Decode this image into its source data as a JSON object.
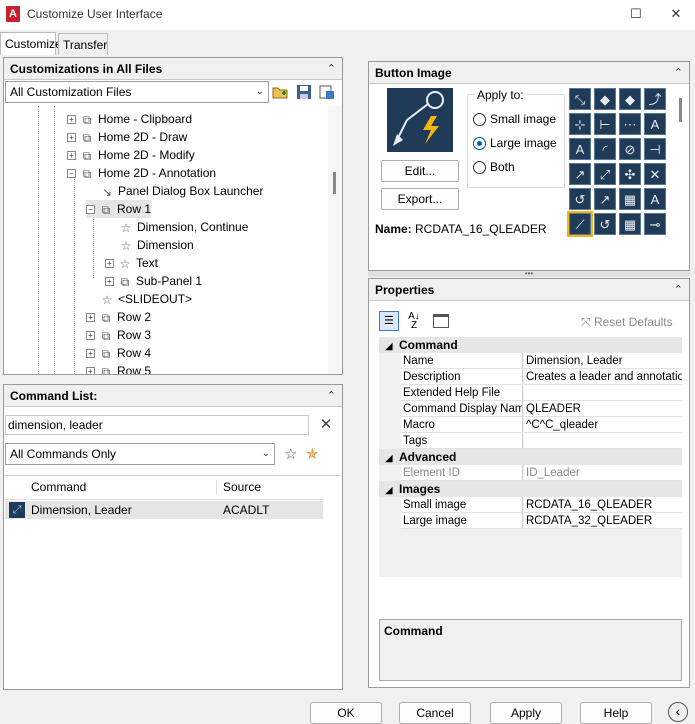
{
  "window": {
    "title": "Customize User Interface",
    "app_icon_letter": "A",
    "maximize_symbol": "☐",
    "close_symbol": "✕"
  },
  "tabs": [
    {
      "label": "Customize",
      "active": true
    },
    {
      "label": "Transfer",
      "active": false
    }
  ],
  "customizations_panel": {
    "title": "Customizations in All Files",
    "collapse_symbol": "⌃",
    "file_combo": "All Customization Files",
    "tree": [
      {
        "label": "Home - Clipboard",
        "expander": "+",
        "icon": "panel-icon"
      },
      {
        "label": "Home 2D - Draw",
        "expander": "+",
        "icon": "panel-icon"
      },
      {
        "label": "Home 2D - Modify",
        "expander": "+",
        "icon": "panel-icon"
      },
      {
        "label": "Home 2D - Annotation",
        "expander": "−",
        "icon": "panel-icon"
      },
      {
        "label": "Panel Dialog Box Launcher",
        "expander": "",
        "icon": "launcher-icon"
      },
      {
        "label": "Row 1",
        "expander": "−",
        "icon": "row-icon"
      },
      {
        "label": "Dimension, Continue",
        "expander": "",
        "icon": "command-star-icon"
      },
      {
        "label": "Dimension",
        "expander": "",
        "icon": "command-star-icon"
      },
      {
        "label": "Text",
        "expander": "+",
        "icon": "command-star-icon"
      },
      {
        "label": "Sub-Panel 1",
        "expander": "+",
        "icon": "subpanel-icon"
      },
      {
        "label": "<SLIDEOUT>",
        "expander": "",
        "icon": "command-star-icon"
      },
      {
        "label": "Row 2",
        "expander": "+",
        "icon": "row-icon"
      },
      {
        "label": "Row 3",
        "expander": "+",
        "icon": "row-icon"
      },
      {
        "label": "Row 4",
        "expander": "+",
        "icon": "row-icon"
      },
      {
        "label": "Row 5",
        "expander": "+",
        "icon": "row-icon"
      }
    ]
  },
  "command_list": {
    "title": "Command List:",
    "collapse_symbol": "⌃",
    "search_value": "dimension, leader",
    "clear_symbol": "✕",
    "filter_combo": "All Commands Only",
    "columns": [
      "Command",
      "Source"
    ],
    "rows": [
      {
        "command": "Dimension, Leader",
        "source": "ACADLT"
      }
    ]
  },
  "button_image": {
    "title": "Button Image",
    "collapse_symbol": "⌃",
    "edit_label": "Edit...",
    "export_label": "Export...",
    "apply_to_label": "Apply to:",
    "options": [
      {
        "label": "Small image",
        "selected": false
      },
      {
        "label": "Large image",
        "selected": true
      },
      {
        "label": "Both",
        "selected": false
      }
    ],
    "name_label": "Name:",
    "name_value": "RCDATA_16_QLEADER",
    "icon_grid_glyphs": [
      "⤡",
      "◆",
      "◆",
      "⤴",
      "⊹",
      "⊢",
      "⋯",
      "A",
      "A",
      "◜",
      "⊘",
      "⊣",
      "↗",
      "⤢",
      "✣",
      "✕",
      "↺",
      "↗",
      "▦",
      "A",
      "⟋",
      "↺",
      "▦",
      "⊸"
    ]
  },
  "properties": {
    "title": "Properties",
    "collapse_symbol": "⌃",
    "reset_label": "Reset Defaults",
    "categories": [
      {
        "name": "Command",
        "rows": [
          {
            "name": "Name",
            "value": "Dimension, Leader"
          },
          {
            "name": "Description",
            "value": "Creates a leader and annotation:"
          },
          {
            "name": "Extended Help File",
            "value": ""
          },
          {
            "name": "Command Display Nam",
            "value": "QLEADER"
          },
          {
            "name": "Macro",
            "value": "^C^C_qleader"
          },
          {
            "name": "Tags",
            "value": ""
          }
        ]
      },
      {
        "name": "Advanced",
        "rows": [
          {
            "name": "Element ID",
            "value": "ID_Leader",
            "disabled": true
          }
        ]
      },
      {
        "name": "Images",
        "rows": [
          {
            "name": "Small image",
            "value": "RCDATA_16_QLEADER"
          },
          {
            "name": "Large image",
            "value": "RCDATA_32_QLEADER"
          }
        ]
      }
    ],
    "description_title": "Command"
  },
  "footer": {
    "ok": "OK",
    "cancel": "Cancel",
    "apply": "Apply",
    "help": "Help",
    "back_symbol": "‹"
  },
  "colors": {
    "accent": "#c8202f",
    "selection": "#cce4f7",
    "icon_bg": "#1f3b57"
  }
}
